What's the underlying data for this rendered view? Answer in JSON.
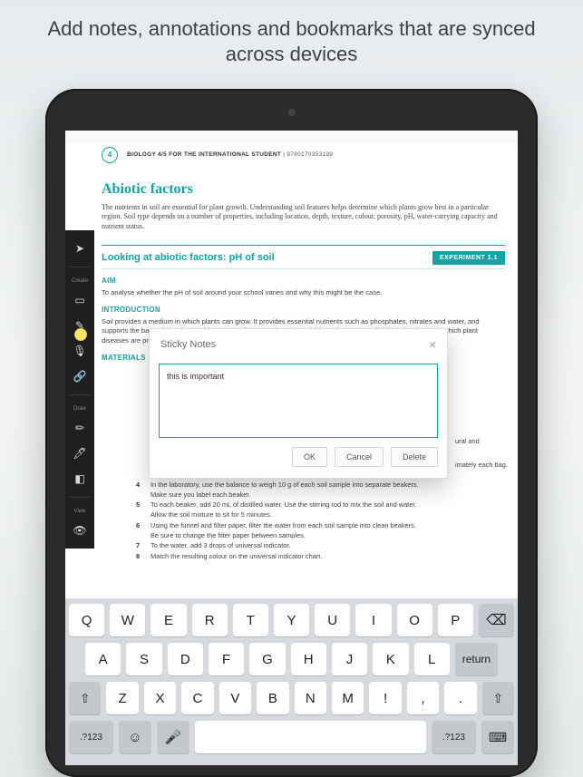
{
  "headline": "Add notes, annotations and bookmarks that are synced across devices",
  "page": {
    "number": "4",
    "header_book": "BIOLOGY 4/5 FOR THE INTERNATIONAL STUDENT",
    "header_sep": " | ",
    "header_isbn": "9780170353199",
    "section_title": "Abiotic factors",
    "intro": "The nutrients in soil are essential for plant growth. Understanding soil features helps determine which plants grow best in a particular region. Soil type depends on a number of properties, including location, depth, texture, colour, porosity, pH, water-carrying capacity and nutrient status.",
    "experiment_title": "Looking at abiotic factors: pH of soil",
    "experiment_tag": "EXPERIMENT 1.1",
    "aim_h": "AIM",
    "aim": "To analyse whether the pH of soil around your school varies and why this might be the case.",
    "intro_h": "INTRODUCTION",
    "intro2": "Soil provides a medium in which plants can grow. It provides essential nutrients such as phosphates, nitrates and water, and supports the base of the plant and its roots. Soil pH can determine which nutrients are available to the plant and which plant diseases are present.",
    "mat_h": "MATERIALS",
    "frag1": "ural and",
    "frag2": "imately each bag.",
    "step4a": "In the laboratory, use the balance to weigh 10 g of each soil sample into separate beakers.",
    "step4b": "Make sure you label each beaker.",
    "step5a": "To each beaker, add 20 mL of distilled water. Use the stirring rod to mix the soil and water.",
    "step5b": "Allow the soil mixture to sit for 5 minutes.",
    "step6a": "Using the funnel and filter paper, filter the water from each soil sample into clean beakers.",
    "step6b": "Be sure to change the filter paper between samples.",
    "step7": "To the water, add 3 drops of universal indicator.",
    "step8": "Match the resulting colour on the universal indicator chart."
  },
  "toolbar": {
    "create": "Create",
    "draw": "Draw",
    "view": "View"
  },
  "sticky": {
    "title": "Sticky Notes",
    "text": "this is important",
    "ok": "OK",
    "cancel": "Cancel",
    "delete": "Delete"
  },
  "kbd": {
    "row1": [
      "Q",
      "W",
      "E",
      "R",
      "T",
      "Y",
      "U",
      "I",
      "O",
      "P"
    ],
    "row2": [
      "A",
      "S",
      "D",
      "F",
      "G",
      "H",
      "J",
      "K",
      "L"
    ],
    "row3": [
      "Z",
      "X",
      "C",
      "V",
      "B",
      "N",
      "M",
      "!",
      ",",
      "."
    ],
    "shift": "⇧",
    "backspace": "⌫",
    "num": ".?123",
    "return": "return",
    "dismiss": "⌨"
  }
}
